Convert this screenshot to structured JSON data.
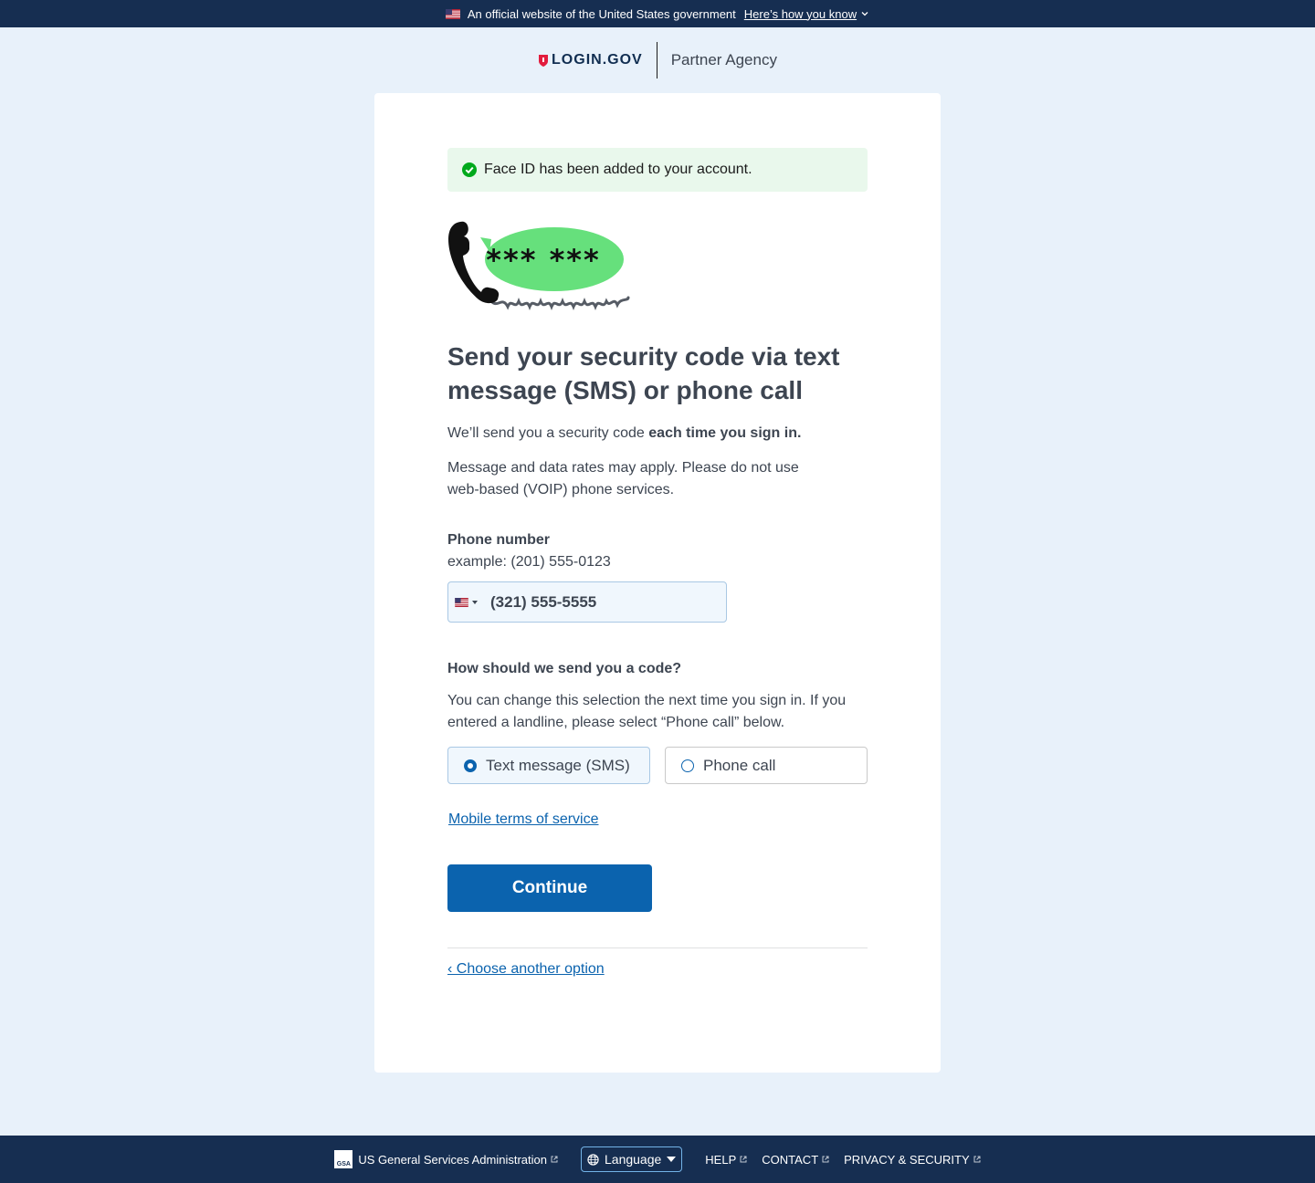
{
  "gov_banner": {
    "text": "An official website of the United States government",
    "link": "Here’s how you know"
  },
  "header": {
    "logo": "LOGIN.GOV",
    "partner": "Partner Agency"
  },
  "alert": {
    "text": "Face ID has been added to your account."
  },
  "illustration": {
    "bubble_text": "*** ***"
  },
  "main": {
    "title": "Send your security code via text message (SMS) or phone call",
    "intro_prefix": "We’ll send you a security code ",
    "intro_bold": "each time you sign in.",
    "rates_text": "Message and data rates may apply. Please do not use web-based (VOIP) phone services."
  },
  "phone": {
    "label": "Phone number",
    "hint": "example: (201) 555-0123",
    "value": "(321) 555-5555"
  },
  "delivery": {
    "question": "How should we send you a code?",
    "hint": "You can change this selection the next time you sign in. If you entered a landline, please select “Phone call” below.",
    "options": [
      {
        "label": "Text message (SMS)",
        "selected": true
      },
      {
        "label": "Phone call",
        "selected": false
      }
    ]
  },
  "links": {
    "terms": "Mobile terms of service",
    "back": "‹ Choose another option"
  },
  "buttons": {
    "continue": "Continue"
  },
  "footer": {
    "gsa_logo": "GSA",
    "gsa": "US General Services Administration",
    "language": "Language",
    "help": "HELP",
    "contact": "CONTACT",
    "privacy": "PRIVACY & SECURITY"
  },
  "colors": {
    "primary": "#0b63ae",
    "navy": "#162e51",
    "success_bg": "#e9f8ec",
    "success_icon": "#00a91c",
    "bubble": "#66e07c"
  }
}
